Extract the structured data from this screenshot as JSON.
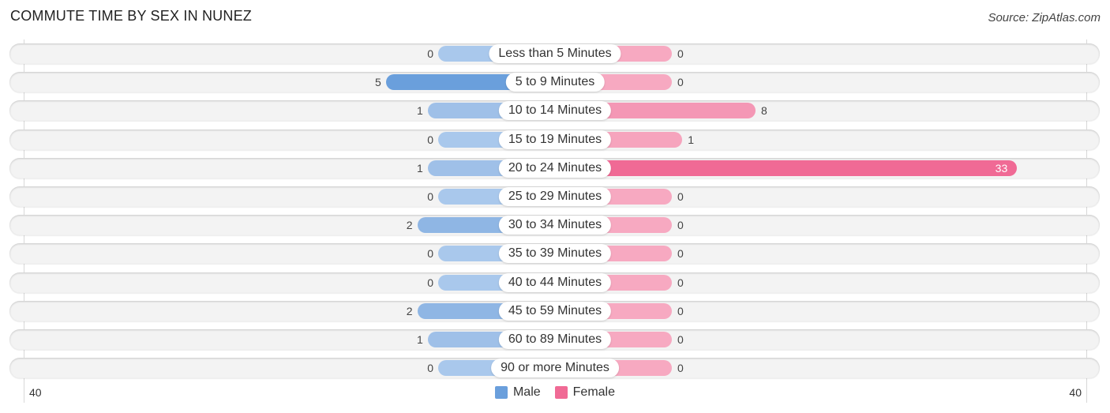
{
  "header": {
    "title": "COMMUTE TIME BY SEX IN NUNEZ",
    "source": "Source: ZipAtlas.com"
  },
  "colors": {
    "male": "#6a9fdc",
    "male_light": "#a9c8ec",
    "female": "#f06a95",
    "female_light": "#f7a9c1"
  },
  "chart_data": {
    "type": "bar",
    "orientation": "horizontal-diverging",
    "title": "COMMUTE TIME BY SEX IN NUNEZ",
    "categories": [
      "Less than 5 Minutes",
      "5 to 9 Minutes",
      "10 to 14 Minutes",
      "15 to 19 Minutes",
      "20 to 24 Minutes",
      "25 to 29 Minutes",
      "30 to 34 Minutes",
      "35 to 39 Minutes",
      "40 to 44 Minutes",
      "45 to 59 Minutes",
      "60 to 89 Minutes",
      "90 or more Minutes"
    ],
    "series": [
      {
        "name": "Male",
        "values": [
          0,
          5,
          1,
          0,
          1,
          0,
          2,
          0,
          0,
          2,
          1,
          0
        ]
      },
      {
        "name": "Female",
        "values": [
          0,
          0,
          8,
          1,
          33,
          0,
          0,
          0,
          0,
          0,
          0,
          0
        ]
      }
    ],
    "axis_min_label": "40",
    "axis_max_label": "40",
    "xlim": [
      -40,
      40
    ],
    "legend": {
      "position": "bottom-center",
      "entries": [
        "Male",
        "Female"
      ]
    },
    "grid": false
  }
}
